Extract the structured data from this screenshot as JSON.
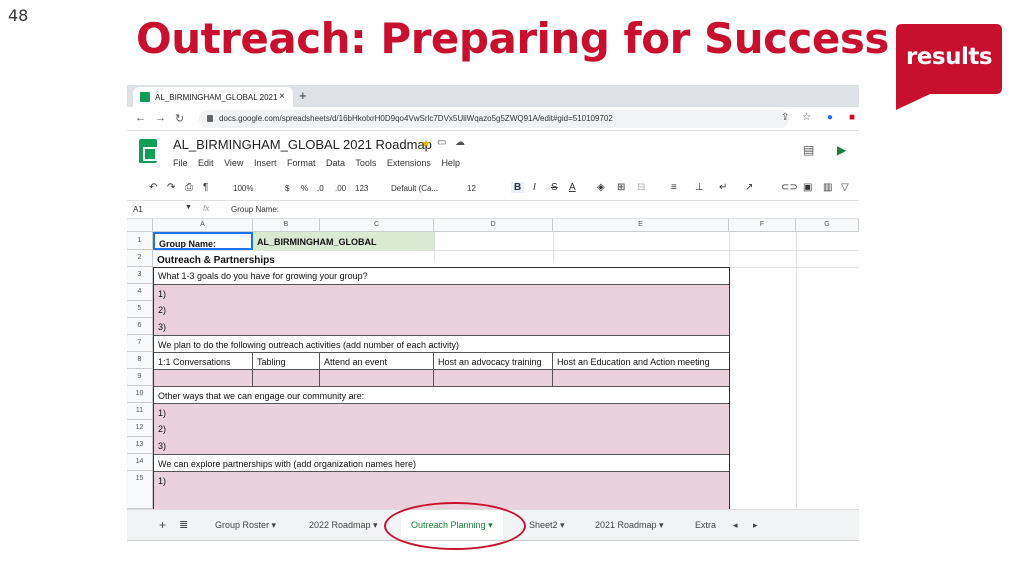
{
  "slide": {
    "number": "48",
    "title": "Outreach: Preparing for Success",
    "logo_text": "results",
    "brand_color": "#c8102e"
  },
  "browser": {
    "tab_title": "AL_BIRMINGHAM_GLOBAL 2021",
    "tab_close": "×",
    "new_tab": "+",
    "url": "docs.google.com/spreadsheets/d/16bHkolxrH0D9qo4VwSrlc7DVx5UliWqazo5g5ZWQ91A/edit#gid=510109702"
  },
  "sheets": {
    "doc_title": "AL_BIRMINGHAM_GLOBAL 2021 Roadmap",
    "menu": [
      "File",
      "Edit",
      "View",
      "Insert",
      "Format",
      "Data",
      "Tools",
      "Extensions",
      "Help"
    ],
    "toolbar": {
      "zoom": "100%",
      "currency": "$",
      "percent": "%",
      "dec_less": ".0",
      "dec_more": ".00",
      "format": "123",
      "font": "Default (Ca...",
      "font_size": "12",
      "bold": "B",
      "italic": "I",
      "strike": "S",
      "text_color": "A"
    },
    "cell_ref": "A1",
    "fx": "fx",
    "formula": "Group Name:",
    "columns": [
      "A",
      "B",
      "C",
      "D",
      "E",
      "F",
      "G"
    ],
    "rows": [
      "1",
      "2",
      "3",
      "4",
      "5",
      "6",
      "7",
      "8",
      "9",
      "10",
      "11",
      "12",
      "13",
      "14",
      "15"
    ],
    "cells": {
      "a1": "Group Name:",
      "b1": "AL_BIRMINGHAM_GLOBAL",
      "a2": "Outreach & Partnerships",
      "a3": "What 1-3 goals do you have for growing your group?",
      "a4": "1)",
      "a5": "2)",
      "a6": "3)",
      "a7": "We plan to do the following outreach activities (add number of each activity)",
      "a8": "1:1 Conversations",
      "b8": "Tabling",
      "c8": "Attend an event",
      "d8": "Host an advocacy training",
      "e8": "Host an Education and Action meeting",
      "a10": "Other ways that we can engage our community are:",
      "a11": "1)",
      "a12": "2)",
      "a13": "3)",
      "a14": "We can explore partnerships with (add organization names here)",
      "a15": "1)"
    },
    "sheet_tabs": [
      "Group Roster",
      "2022 Roadmap",
      "Outreach Planning",
      "Sheet2",
      "2021 Roadmap",
      "Extra"
    ],
    "active_tab": "Outreach Planning",
    "pink_fill": "#ead1dc",
    "selected_fill": "#d9ead3"
  }
}
